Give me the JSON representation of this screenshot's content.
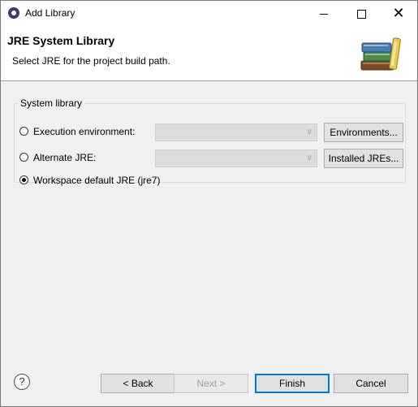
{
  "window": {
    "title": "Add Library"
  },
  "header": {
    "title": "JRE System Library",
    "description": "Select JRE for the project build path."
  },
  "group": {
    "legend": "System library",
    "options": [
      {
        "label": "Execution environment:",
        "selected": false,
        "button": "Environments..."
      },
      {
        "label": "Alternate JRE:",
        "selected": false,
        "button": "Installed JREs..."
      },
      {
        "label": "Workspace default JRE (jre7)",
        "selected": true
      }
    ]
  },
  "footer": {
    "back": "< Back",
    "next": "Next >",
    "finish": "Finish",
    "cancel": "Cancel",
    "help": "?"
  },
  "colors": {
    "accent": "#0078d7",
    "disabled_text": "#a0a0a0"
  },
  "icons": [
    "app-icon",
    "books-icon",
    "help-icon",
    "minimize-icon",
    "maximize-icon",
    "close-icon"
  ]
}
